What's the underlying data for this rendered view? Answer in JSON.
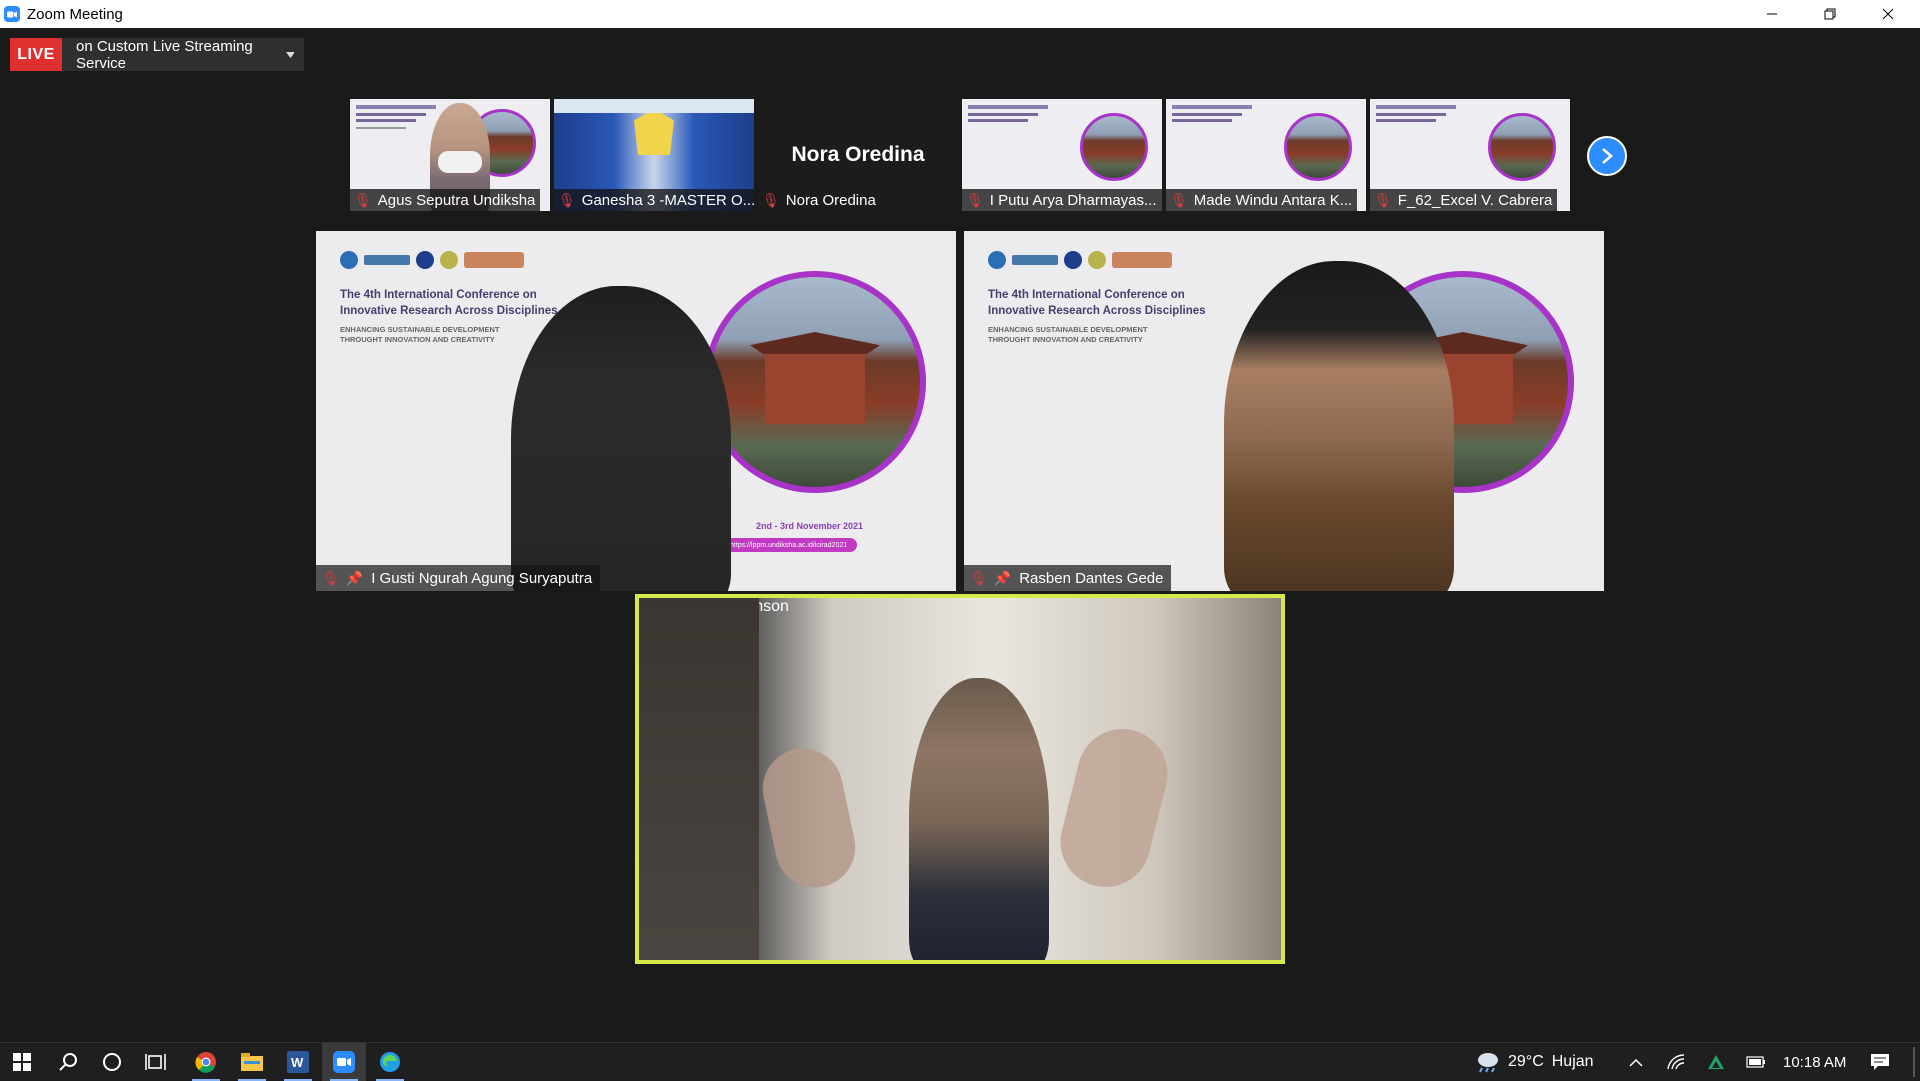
{
  "window": {
    "title": "Zoom Meeting",
    "minimize_icon": "minimize-icon",
    "restore_icon": "restore-icon",
    "close_icon": "close-icon"
  },
  "live": {
    "badge": "LIVE",
    "service": "on Custom Live Streaming Service",
    "badge_color": "#e02f2f"
  },
  "thumbnails": [
    {
      "name": "Agus Seputra Undiksha",
      "muted": true
    },
    {
      "name": "Ganesha 3 -MASTER O...",
      "muted": true
    },
    {
      "name": "Nora Oredina",
      "muted": true,
      "display_name": "Nora Oredina"
    },
    {
      "name": "I Putu Arya Dharmayas...",
      "muted": true
    },
    {
      "name": "Made Windu Antara K...",
      "muted": true
    },
    {
      "name": "F_62_Excel V. Cabrera",
      "muted": true
    }
  ],
  "main_tiles": [
    {
      "name": "I Gusti Ngurah Agung Suryaputra",
      "muted": true,
      "pinned": true
    },
    {
      "name": "Rasben Dantes Gede",
      "muted": true,
      "pinned": true
    }
  ],
  "active_speaker": {
    "name": "Dor Abrahamson",
    "pinned": true,
    "border_color": "#d7e84a"
  },
  "slide": {
    "title_line1": "The 4th International Conference on",
    "title_line2": "Innovative Research Across Disciplines",
    "sub_line1": "ENHANCING SUSTAINABLE DEVELOPMENT",
    "sub_line2": "THROUGHT INNOVATION AND CREATIVITY",
    "dates": "2nd - 3rd November 2021",
    "url": "https://lppm.undiksha.ac.id/icirad2021"
  },
  "taskbar": {
    "weather_temp": "29°C",
    "weather_desc": "Hujan",
    "time": "10:18 AM",
    "icons": [
      "windows-start-icon",
      "search-icon",
      "cortana-icon",
      "task-view-icon",
      "chrome-icon",
      "file-explorer-icon",
      "word-icon",
      "zoom-icon",
      "edge-icon"
    ]
  }
}
